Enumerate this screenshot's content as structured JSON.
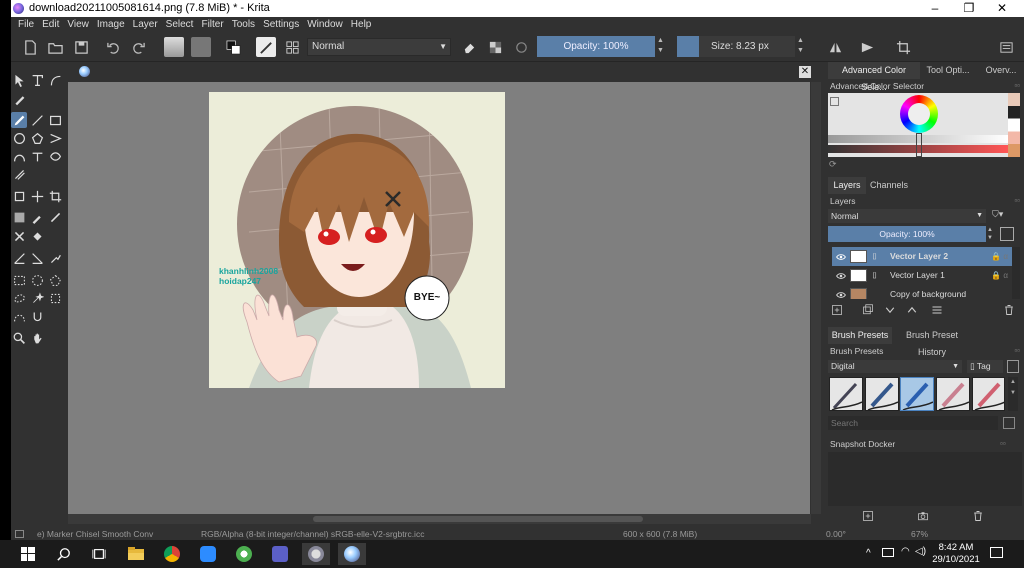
{
  "window": {
    "title": "download20211005081614.png (7.8 MiB)  * - Krita",
    "controls": [
      "–",
      "❐",
      "✕"
    ]
  },
  "menu": [
    "File",
    "Edit",
    "View",
    "Image",
    "Layer",
    "Select",
    "Filter",
    "Tools",
    "Settings",
    "Window",
    "Help"
  ],
  "toolbar": {
    "blend_mode": "Normal",
    "opacity_label": "Opacity: 100%",
    "opacity_value": 100,
    "size_label": "Size: 8.23 px"
  },
  "canvas": {
    "watermark_line1": "khanhlinh2008",
    "watermark_line2": "hoidap247",
    "bubble_text": "BYE~",
    "close_label": "✕"
  },
  "status": {
    "brush": "e) Marker Chisel Smooth Conv",
    "color_space": "RGB/Alpha (8-bit integer/channel)  sRGB-elle-V2-srgbtrc.icc",
    "dimensions": "600 x 600 (7.8 MiB)",
    "rotation": "0.00°",
    "zoom": "67%"
  },
  "dock": {
    "top_tabs": [
      "Advanced Color Sele...",
      "Tool Opti...",
      "Overv..."
    ],
    "color_selector_title": "Advanced Color Selector",
    "layers_tabs": [
      "Layers",
      "Channels"
    ],
    "layers_title": "Layers",
    "layer_blend": "Normal",
    "layer_opacity_label": "Opacity:  100%",
    "layers": [
      {
        "name": "Vector Layer 2",
        "selected": true
      },
      {
        "name": "Vector Layer 1",
        "selected": false
      },
      {
        "name": "Copy of background",
        "selected": false
      }
    ],
    "brush_tabs": [
      "Brush Presets",
      "Brush Preset History"
    ],
    "brush_presets_title": "Brush Presets",
    "brush_tag_select": "Digital",
    "tag_label": "Tag",
    "search_placeholder": "Search",
    "snapshot_title": "Snapshot Docker"
  },
  "taskbar": {
    "time": "8:42 AM",
    "date": "29/10/2021"
  },
  "colors": {
    "accent": "#5a7fa8",
    "panel": "#313131",
    "canvas_bg": "#7f7f7f",
    "artwork_bg": "#ecedd9",
    "watermark": "#19a59e"
  }
}
